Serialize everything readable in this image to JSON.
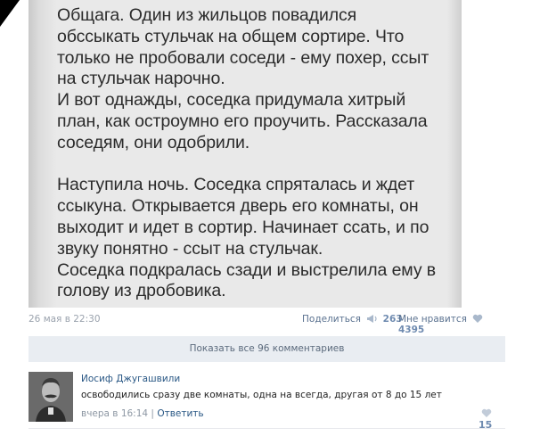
{
  "post": {
    "image_lines": [
      "Общага. Один из жильцов повадился",
      "обссыкать стульчак на общем сортире. Что",
      "только не пробовали соседи - ему похер, ссыт",
      "на стульчак нарочно.",
      "И вот однажды, соседка придумала хитрый",
      "план, как остроумно его проучить. Рассказала",
      "соседям, они одобрили.",
      "",
      "Наступила ночь. Соседка спряталась и ждет",
      "ссыкуна. Открывается дверь его комнаты, он",
      "выходит и идет в сортир. Начинает ссать, и по",
      "звуку понятно - ссыт на стульчак.",
      "Соседка подкралась сзади и выстрелила ему в",
      "голову из дробовика."
    ],
    "date": "26 мая в 22:30",
    "share_label": "Поделиться",
    "share_count": "263",
    "share_icon": "megaphone-icon",
    "like_label": "Мне нравится",
    "like_count": "4395",
    "like_icon": "heart-icon"
  },
  "comments_toggle": {
    "label": "Показать все 96 комментариев"
  },
  "comment": {
    "author": "Иосиф Джугашвили",
    "text": "освободились сразу две комнаты, одна на всегда, другая от 8 до 15 лет",
    "time": "вчера в 16:14",
    "separator": "|",
    "reply_label": "Ответить",
    "like_count": "15",
    "like_icon": "heart-icon"
  },
  "colors": {
    "link": "#2a5885",
    "meta": "#9aa2ad",
    "like_accent": "#6f8bb0",
    "button_bg": "#e9edf2"
  }
}
